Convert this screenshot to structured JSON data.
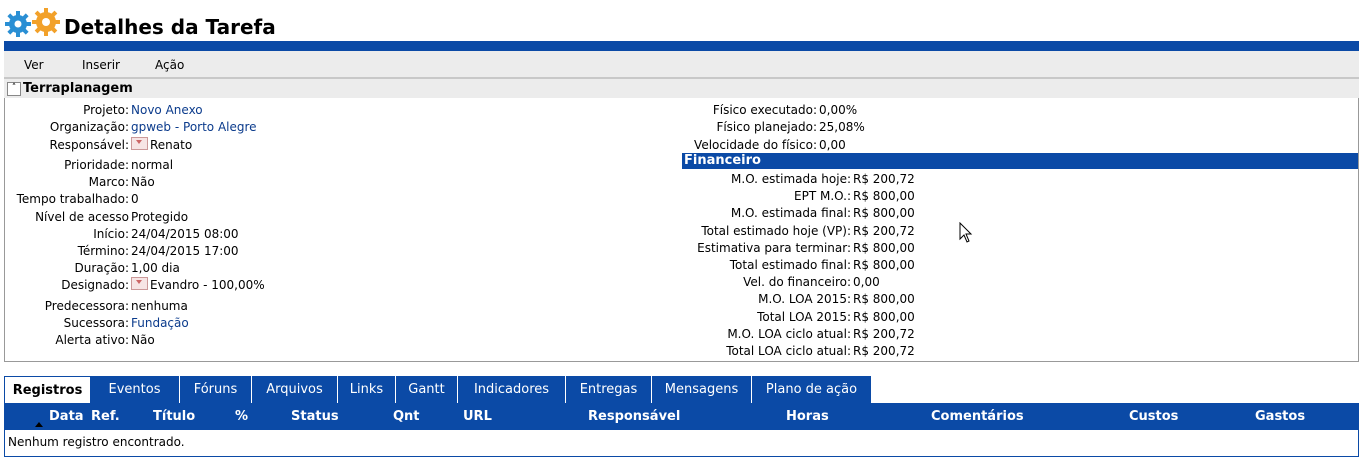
{
  "header": {
    "title": "Detalhes da Tarefa",
    "logo_icon": "gears-logo-icon"
  },
  "menu": [
    "Ver",
    "Inserir",
    "Ação"
  ],
  "section": {
    "title": "Terraplanagem",
    "collapse_icon": "collapse-up-icon"
  },
  "left_fields": [
    {
      "label": "Projeto:",
      "value": "Novo Anexo",
      "link": true
    },
    {
      "label": "Organização:",
      "value": "gpweb - Porto Alegre",
      "link": true
    },
    {
      "label": "Responsável:",
      "value": "Renato",
      "icon": true
    },
    {
      "label": "Prioridade:",
      "value": "normal"
    },
    {
      "label": "Marco:",
      "value": "Não"
    },
    {
      "label": "Tempo trabalhado:",
      "value": "0"
    },
    {
      "label": "Nível de acesso",
      "value": "Protegido"
    },
    {
      "label": "Início:",
      "value": "24/04/2015 08:00"
    },
    {
      "label": "Término:",
      "value": "24/04/2015 17:00"
    },
    {
      "label": "Duração:",
      "value": "1,00 dia"
    },
    {
      "label": "Designado:",
      "value": "Evandro - 100,00%",
      "icon": true
    },
    {
      "label": "Predecessora:",
      "value": "nenhuma"
    },
    {
      "label": "Sucessora:",
      "value": "Fundação",
      "link": true
    },
    {
      "label": "Alerta ativo:",
      "value": "Não"
    }
  ],
  "right_top_fields": [
    {
      "label": "Físico executado:",
      "value": "0,00%"
    },
    {
      "label": "Físico planejado:",
      "value": "25,08%"
    },
    {
      "label": "Velocidade do físico:",
      "value": "0,00"
    }
  ],
  "financeiro_title": "Financeiro",
  "financeiro_fields": [
    {
      "label": "M.O. estimada hoje:",
      "value": "R$ 200,72"
    },
    {
      "label": "EPT M.O.:",
      "value": "R$ 800,00"
    },
    {
      "label": "M.O. estimada final:",
      "value": "R$ 800,00"
    },
    {
      "label": "Total estimado hoje (VP):",
      "value": "R$ 200,72"
    },
    {
      "label": "Estimativa para terminar:",
      "value": "R$ 800,00"
    },
    {
      "label": "Total estimado final:",
      "value": "R$ 800,00"
    },
    {
      "label": "Vel. do financeiro:",
      "value": "0,00"
    },
    {
      "label": "M.O. LOA 2015:",
      "value": "R$ 800,00"
    },
    {
      "label": "Total LOA 2015:",
      "value": "R$ 800,00"
    },
    {
      "label": "M.O. LOA ciclo atual:",
      "value": "R$ 200,72"
    },
    {
      "label": "Total LOA ciclo atual:",
      "value": "R$ 200,72"
    }
  ],
  "tabs": [
    "Registros",
    "Eventos",
    "Fóruns",
    "Arquivos",
    "Links",
    "Gantt",
    "Indicadores",
    "Entregas",
    "Mensagens",
    "Plano de ação"
  ],
  "active_tab": "Registros",
  "columns": [
    "Data",
    "Ref.",
    "Título",
    "%",
    "Status",
    "Qnt",
    "URL",
    "Responsável",
    "Horas",
    "Comentários",
    "Custos",
    "Gastos"
  ],
  "empty_message": "Nenhum registro encontrado.",
  "colors": {
    "accent": "#0b4aa6",
    "menu_bg": "#ececec",
    "link": "#0b3b8c"
  }
}
